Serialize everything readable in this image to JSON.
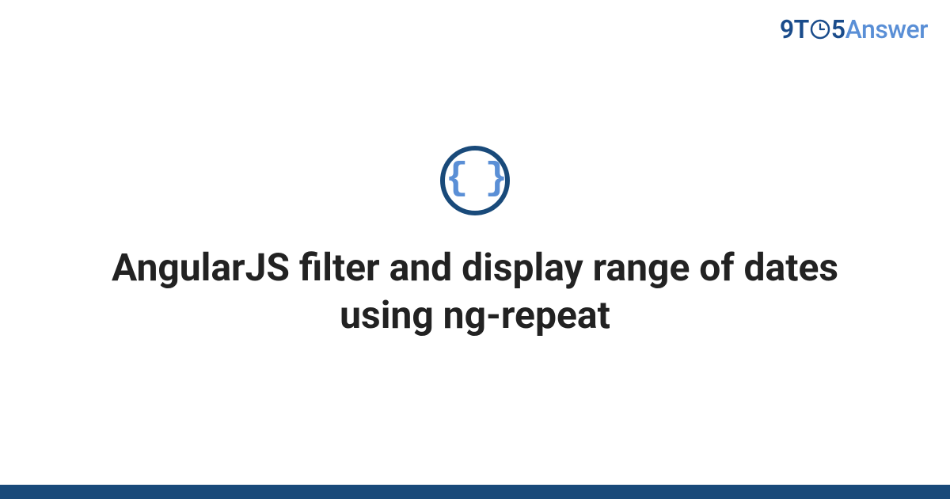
{
  "brand": {
    "part1": "9",
    "part2": "T",
    "part3": "5",
    "part4": "Answer"
  },
  "icon": {
    "name": "braces-icon",
    "glyph": "{ }",
    "border_color": "#194a7a",
    "inner_color": "#5a8fd6"
  },
  "title": "AngularJS filter and display range of dates using ng-repeat",
  "footer_color": "#194a7a"
}
